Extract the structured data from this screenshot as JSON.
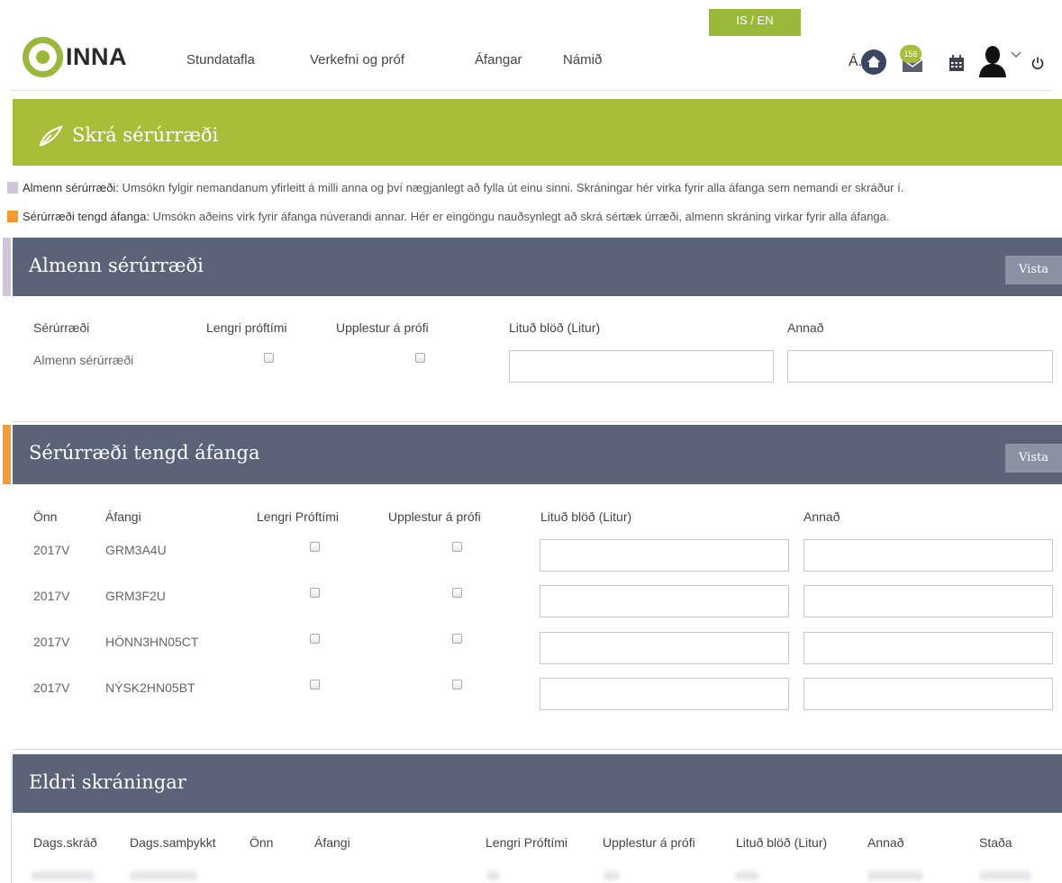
{
  "header": {
    "lang_toggle": "IS / EN",
    "logo_text": "INNA",
    "nav": [
      "Stundatafla",
      "Verkefni og próf",
      "Áfangar",
      "Námið"
    ],
    "user_initial": "Á.",
    "mail_badge": "156",
    "icons": [
      "home-icon",
      "mail-icon",
      "calendar-icon",
      "user-icon",
      "chevron-down-icon",
      "power-icon"
    ]
  },
  "page": {
    "title": "Skrá sérúrræði"
  },
  "legend": {
    "general_label": "Almenn sérúrræði:",
    "general_text": " Umsókn fylgir nemandanum yfirleitt á milli anna og því nægjanlegt að fylla út einu sinni. Skráningar hér virka fyrir alla áfanga sem nemandi er skráður í.",
    "course_label": "Sérúrræði tengd áfanga:",
    "course_text": " Umsókn aðeins virk fyrir áfanga núverandi annar. Hér er eingöngu nauðsynlegt að skrá sértæk úrræði, almenn skráning virkar fyrir alla áfanga."
  },
  "general": {
    "heading": "Almenn sérúrræði",
    "save": "Vista",
    "cols": [
      "Sérúrræði",
      "Lengri próftími",
      "Upplestur á prófi",
      "Lituð blöð (Litur)",
      "Annað"
    ],
    "row_label": "Almenn sérúrræði",
    "color_value": "",
    "other_value": ""
  },
  "course": {
    "heading": "Sérúrræði tengd áfanga",
    "save": "Vista",
    "cols": [
      "Önn",
      "Áfangi",
      "Lengri Próftími",
      "Upplestur á prófi",
      "Lituð blöð (Litur)",
      "Annað"
    ],
    "rows": [
      {
        "term": "2017V",
        "course": "GRM3A4U"
      },
      {
        "term": "2017V",
        "course": "GRM3F2U"
      },
      {
        "term": "2017V",
        "course": "HÖNN3HN05CT"
      },
      {
        "term": "2017V",
        "course": "NÝSK2HN05BT"
      }
    ]
  },
  "history": {
    "heading": "Eldri skráningar",
    "cols": [
      "Dags.skráð",
      "Dags.samþykkt",
      "Önn",
      "Áfangi",
      "Lengri Próftími",
      "Upplestur á prófi",
      "Lituð blöð (Litur)",
      "Annað",
      "Staða"
    ]
  },
  "colors": {
    "accent_green": "#9ab93a",
    "banner_green": "#a9bd38",
    "section_slate": "#5a6377",
    "general_marker": "#cfc6dc",
    "course_marker": "#f59b32"
  }
}
